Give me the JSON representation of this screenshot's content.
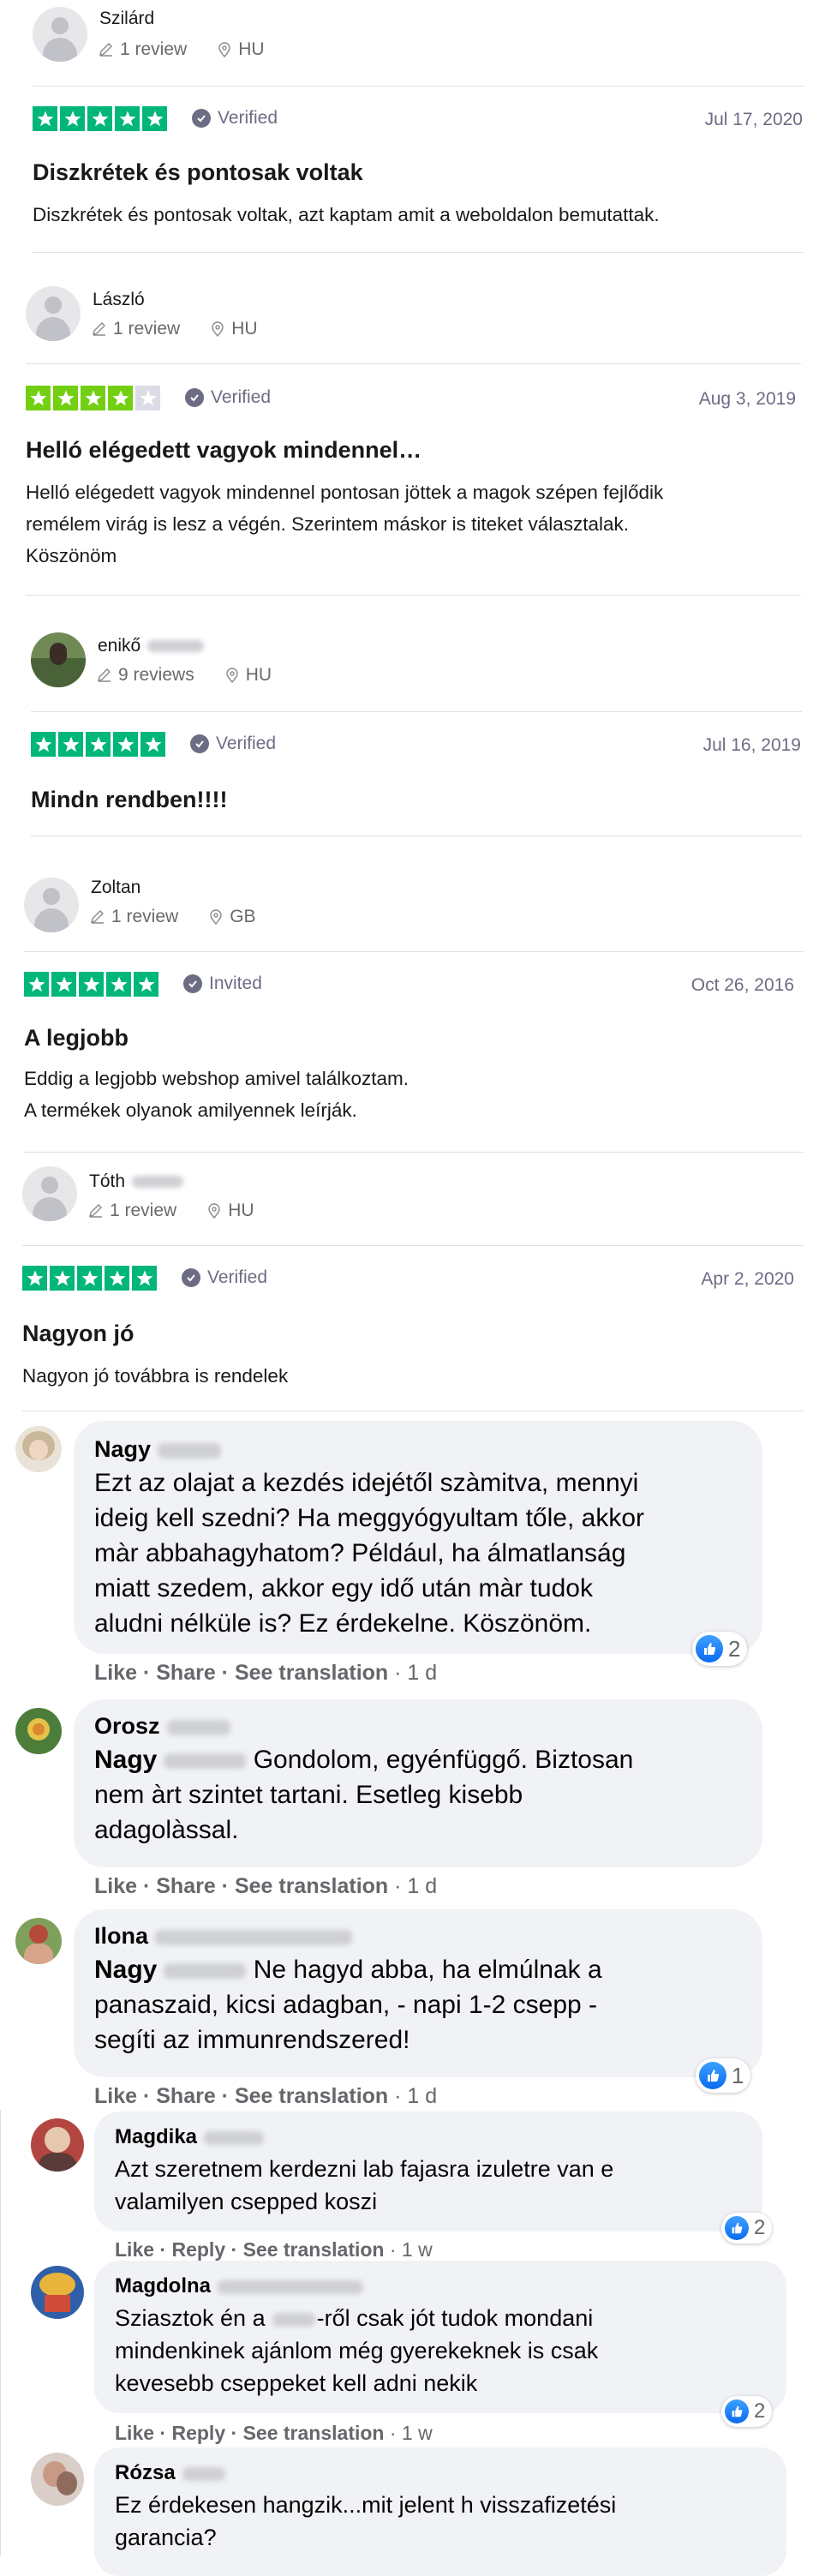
{
  "colors": {
    "trustpilot_green": "#00b67a",
    "star_grey": "#dcdce6",
    "meta_grey": "#6c6c85",
    "fb_bubble": "#f0f2f5",
    "fb_like": "#1877f2"
  },
  "reviews": [
    {
      "name": "Szilárd",
      "reviews": "1 review",
      "country": "HU",
      "rating": 5,
      "status": "Verified",
      "date": "Jul 17, 2020",
      "title": "Diszkrétek és pontosak voltak",
      "body": [
        "Diszkrétek és pontosak voltak, azt kaptam amit a weboldalon bemutattak."
      ]
    },
    {
      "name": "László",
      "reviews": "1 review",
      "country": "HU",
      "rating": 4,
      "status": "Verified",
      "date": "Aug 3, 2019",
      "title": "Helló elégedett vagyok mindennel…",
      "body": [
        "Helló elégedett vagyok mindennel pontosan jöttek a magok szépen fejlődik",
        "remélem virág is lesz a végén. Szerintem máskor is titeket választalak.",
        "Köszönöm"
      ]
    },
    {
      "name": "enikő",
      "reviews": "9 reviews",
      "country": "HU",
      "rating": 5,
      "status": "Verified",
      "date": "Jul 16, 2019",
      "title": "Mindn rendben!!!!",
      "body": []
    },
    {
      "name": "Zoltan",
      "reviews": "1 review",
      "country": "GB",
      "rating": 5,
      "status": "Invited",
      "date": "Oct 26, 2016",
      "title": "A legjobb",
      "body": [
        "Eddig a legjobb webshop amivel találkoztam.",
        "A termékek olyanok amilyennek leírják."
      ]
    },
    {
      "name": "Tóth",
      "reviews": "1 review",
      "country": "HU",
      "rating": 5,
      "status": "Verified",
      "date": "Apr 2, 2020",
      "title": "Nagyon jó",
      "body": [
        "Nagyon jó továbbra is rendelek"
      ]
    }
  ],
  "comments": [
    {
      "name": "Nagy",
      "lines": [
        "Ezt az olajat a kezdés idejétől szàmitva, mennyi",
        "ideig kell szedni? Ha meggyógyultam tőle, akkor",
        "màr abbahagyhatom? Például, ha álmatlanság",
        "miatt szedem, akkor egy idő után màr tudok",
        "aludni nélküle is? Ez érdekelne. Köszönöm."
      ],
      "actions": [
        "Like",
        "Share",
        "See translation"
      ],
      "time": "1 d",
      "reactions": "2"
    },
    {
      "name": "Orosz",
      "mention": "Nagy",
      "lines": [
        "Gondolom, egyénfüggő. Biztosan",
        "nem àrt szintet tartani. Esetleg kisebb",
        "adagolàssal."
      ],
      "actions": [
        "Like",
        "Share",
        "See translation"
      ],
      "time": "1 d",
      "reactions": ""
    },
    {
      "name": "Ilona",
      "mention": "Nagy",
      "lines": [
        "Ne hagyd abba, ha elmúlnak a",
        "panaszaid, kicsi adagban, - napi 1-2 csepp -",
        "segíti az immunrendszered!"
      ],
      "actions": [
        "Like",
        "Share",
        "See translation"
      ],
      "time": "1 d",
      "reactions": "1"
    },
    {
      "name": "Magdika",
      "lines": [
        "Azt szeretnem kerdezni lab fajasra izuletre van e",
        "valamilyen csepped koszi"
      ],
      "actions": [
        "Like",
        "Reply",
        "See translation"
      ],
      "time": "1 w",
      "reactions": "2"
    },
    {
      "name": "Magdolna",
      "lines": [
        "Sziasztok én a",
        "-ről csak jót tudok mondani",
        "mindenkinek ajánlom még gyerekeknek is csak",
        "kevesebb cseppeket kell adni nekik"
      ],
      "actions": [
        "Like",
        "Reply",
        "See translation"
      ],
      "time": "1 w",
      "reactions": "2"
    },
    {
      "name": "Rózsa",
      "lines": [
        "Ez érdekesen hangzik...mit jelent h visszafizetési",
        "garancia?"
      ],
      "actions": [],
      "time": "",
      "reactions": ""
    }
  ]
}
